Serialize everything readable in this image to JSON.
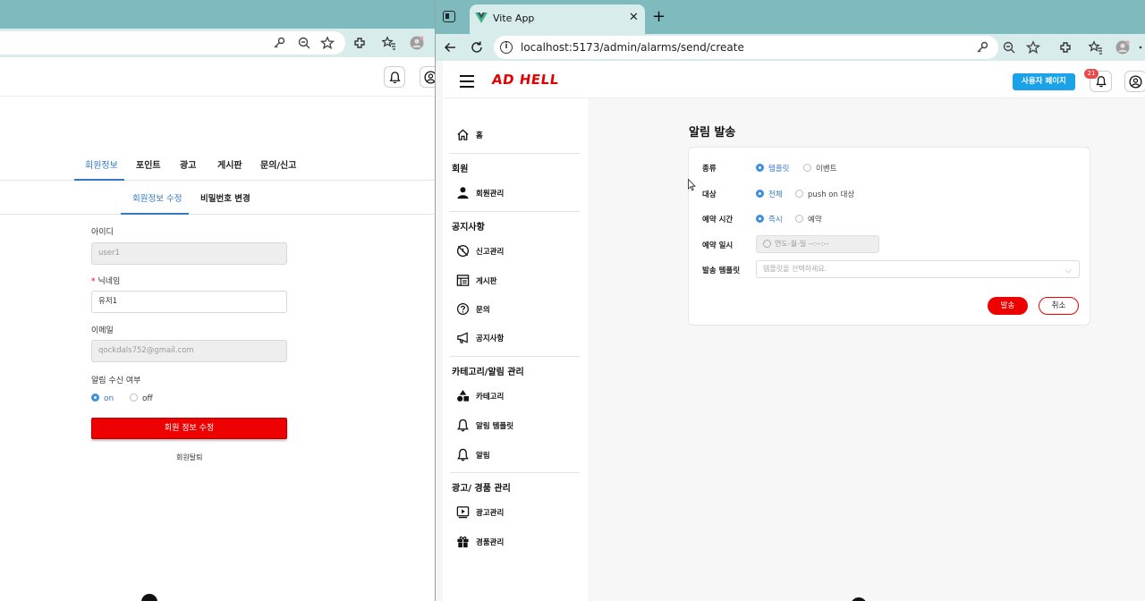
{
  "left_window": {
    "main_tabs": [
      "회원정보",
      "포인트",
      "광고",
      "게시판",
      "문의/신고"
    ],
    "sub_tabs": [
      "회원정보 수정",
      "비밀번호 변경"
    ],
    "form": {
      "id_label": "아이디",
      "id_value": "user1",
      "required_mark": "*",
      "nickname_label": "닉네임",
      "nickname_value": "유저1",
      "email_label": "이메일",
      "email_value": "qockdals752@gmail.com",
      "alarm_label": "알림 수신 여부",
      "alarm_on": "on",
      "alarm_off": "off",
      "submit_label": "회원 정보 수정",
      "withdraw_label": "회원탈퇴"
    }
  },
  "right_window": {
    "tab_title": "Vite App",
    "tab_close": "✕",
    "new_tab": "+",
    "url": "localhost:5173/admin/alarms/send/create",
    "header": {
      "logo": "AD HELL",
      "user_page_button": "사용자 페이지",
      "notification_count": "21"
    },
    "sidebar": {
      "home": "홈",
      "section_member": "회원",
      "member_manage": "회원관리",
      "section_notice": "공지사항",
      "report_manage": "신고관리",
      "board": "게시판",
      "inquiry": "문의",
      "notice": "공지사항",
      "section_category": "카테고리/알림 관리",
      "category": "카테고리",
      "alarm_template": "알림 템플릿",
      "alarm": "알림",
      "section_ad": "광고/ 경품 관리",
      "ad_manage": "광고관리",
      "prize_manage": "경품관리"
    },
    "page_title": "알림 발송",
    "form": {
      "type_label": "종류",
      "type_template": "템플릿",
      "type_event": "이벤트",
      "target_label": "대상",
      "target_all": "전체",
      "target_push": "push on 대상",
      "schedule_label": "예약 시간",
      "schedule_now": "즉시",
      "schedule_reserve": "예약",
      "datetime_label": "예약 일시",
      "datetime_placeholder": "연도-월-일 --:--:--",
      "template_label": "발송 템플릿",
      "template_placeholder": "템플릿을 선택하세요.",
      "send_button": "발송",
      "cancel_button": "취소"
    }
  },
  "colors": {
    "browser_frame": "#7fbbbe",
    "toolbar": "#d9ecec",
    "brand_red": "#ee0000",
    "accent_blue": "#3578c4",
    "user_page_blue": "#1aa3e8"
  }
}
